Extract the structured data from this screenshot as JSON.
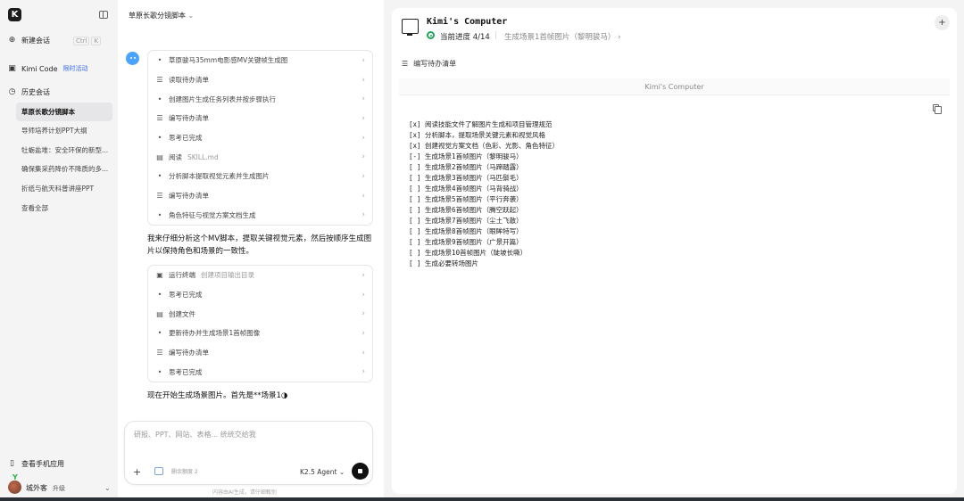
{
  "sidebar": {
    "logo": "K",
    "new_chat": "新建会话",
    "new_chat_shortcut": [
      "Ctrl",
      "K"
    ],
    "kimi_code": "Kimi Code",
    "kimi_code_badge": "限时活动",
    "history_title": "历史会话",
    "history": [
      "草原长歌分镜脚本",
      "导师培养计划PPT大纲",
      "牡蛎盐堆：安全环保的新型...",
      "确保集采药降价不降质的多...",
      "折纸与航天科普讲座PPT",
      "查看全部"
    ],
    "mobile_app": "查看手机应用",
    "user_name": "城外客",
    "upgrade": "升级"
  },
  "chat": {
    "title": "草原长歌分镜脚本",
    "steps_group1": [
      {
        "icon": "dot",
        "text": "草原骏马35mm电影感MV关键帧生成图",
        "sub": ""
      },
      {
        "icon": "list",
        "text": "读取待办清单",
        "sub": ""
      },
      {
        "icon": "dot",
        "text": "创建图片生成任务列表并按步骤执行",
        "sub": ""
      },
      {
        "icon": "list",
        "text": "编写待办清单",
        "sub": ""
      },
      {
        "icon": "dot",
        "text": "思考已完成",
        "sub": ""
      },
      {
        "icon": "doc",
        "text": "阅读",
        "sub": "SKILL.md"
      },
      {
        "icon": "dot",
        "text": "分析脚本提取视觉元素并生成图片",
        "sub": ""
      },
      {
        "icon": "list",
        "text": "编写待办清单",
        "sub": ""
      },
      {
        "icon": "dot",
        "text": "角色特征与视觉方案文档生成",
        "sub": ""
      }
    ],
    "message1": "我来仔细分析这个MV脚本，提取关键视觉元素，然后按顺序生成图片以保持角色和场景的一致性。",
    "steps_group2": [
      {
        "icon": "terminal",
        "text": "运行终端",
        "sub": "创建项目输出目录"
      },
      {
        "icon": "dot",
        "text": "思考已完成",
        "sub": ""
      },
      {
        "icon": "doc",
        "text": "创建文件",
        "sub": ""
      },
      {
        "icon": "dot",
        "text": "更新待办并生成场景1首帧图像",
        "sub": ""
      },
      {
        "icon": "list",
        "text": "编写待办清单",
        "sub": ""
      },
      {
        "icon": "dot",
        "text": "思考已完成",
        "sub": ""
      }
    ],
    "message2": "现在开始生成场景图片。首先是**场景1◑",
    "input_placeholder": "研报、PPT、网站、表格... 统统交给我",
    "attachment_label": "删余额度 2",
    "agent_label": "K2.5 Agent",
    "footer_note": "内容由AI生成，请仔细甄别"
  },
  "panel": {
    "title": "Kimi's Computer",
    "progress_label": "当前进度 4/14",
    "current_task": "生成场景1首帧图片（黎明骏马）",
    "todo_header": "编写待办清单",
    "inner_title": "Kimi's Computer",
    "todos": [
      "[x] 阅读技能文件了解图片生成和项目管理规范",
      "[x] 分析脚本，提取场景关键元素和视觉风格",
      "[x] 创建视觉方案文档（色彩、光影、角色特征）",
      "[-] 生成场景1首帧图片（黎明骏马）",
      "[ ] 生成场景2首帧图片（马蹄踏露）",
      "[ ] 生成场景3首帧图片（马匹鬃毛）",
      "[ ] 生成场景4首帧图片（马背骑战）",
      "[ ] 生成场景5首帧图片（平行奔袭）",
      "[ ] 生成场景6首帧图片（腾空跃起）",
      "[ ] 生成场景7首帧图片（尘土飞散）",
      "[ ] 生成场景8首帧图片（眼眸特写）",
      "[ ] 生成场景9首帧图片（广景开篇）",
      "[ ] 生成场景10首帧图片（陡坡长嘶）",
      "[ ] 生成必要转场图片"
    ]
  },
  "colors": {
    "accent": "#3b6cf6",
    "progress": "#22a35a",
    "send": "#111111"
  }
}
